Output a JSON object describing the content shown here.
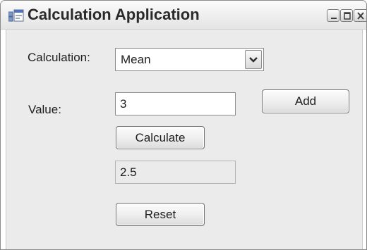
{
  "window": {
    "title": "Calculation Application",
    "icon": "app-window-icon",
    "controls": [
      "minimize-icon",
      "maximize-icon",
      "close-icon"
    ]
  },
  "form": {
    "calculation_label": "Calculation:",
    "calculation_value": "Mean",
    "value_label": "Value:",
    "value_input": "3",
    "add_label": "Add",
    "calculate_label": "Calculate",
    "result_value": "2.5",
    "reset_label": "Reset"
  },
  "colors": {
    "client_background": "#ebebeb",
    "title_text": "#2a2a2a"
  }
}
